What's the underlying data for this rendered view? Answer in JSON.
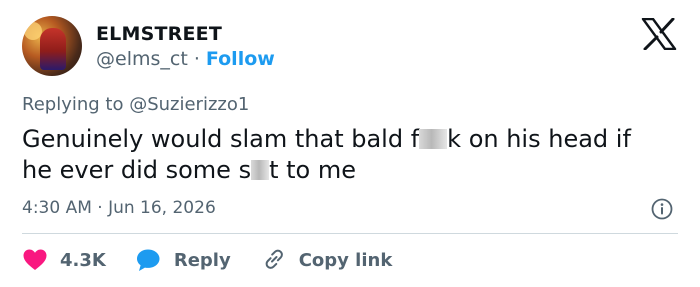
{
  "tweet": {
    "author": {
      "display_name": "ELMSTREET",
      "handle": "@elms_ct",
      "separator": "·",
      "follow_label": "Follow"
    },
    "replying_to": "Replying to @Suzierizzo1",
    "text_line1_part1": "Genuinely would slam that bald f",
    "text_line1_part2": "k on his head if",
    "text_line2_part1": "he ever did some s",
    "text_line2_part2": "t to me",
    "timestamp": "4:30 AM · Jun 16, 2026"
  },
  "actions": {
    "likes_count": "4.3K",
    "reply_label": "Reply",
    "copy_link_label": "Copy link"
  },
  "colors": {
    "accent": "#1d9bf0",
    "like_heart": "#f91880",
    "muted_text": "#536471",
    "divider": "#cfd9de"
  },
  "icons": {
    "brand": "x-logo-icon",
    "info": "info-icon",
    "like": "heart-icon",
    "reply": "speech-bubble-icon",
    "copy_link": "link-icon"
  }
}
